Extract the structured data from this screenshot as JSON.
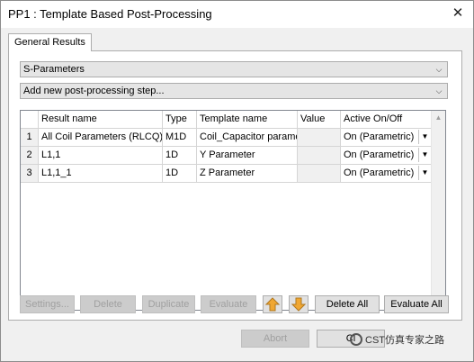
{
  "window": {
    "title": "PP1 : Template Based Post-Processing",
    "close_glyph": "✕"
  },
  "tabs": [
    {
      "label": "General Results"
    }
  ],
  "combos": {
    "result_type": "S-Parameters",
    "add_step": "Add new post-processing step..."
  },
  "table": {
    "headers": [
      "Result name",
      "Type",
      "Template name",
      "Value",
      "Active On/Off"
    ],
    "rows": [
      {
        "num": "1",
        "result_name": "All Coil Parameters (RLCQ)",
        "type": "M1D",
        "template": "Coil_Capacitor paramet",
        "value": "",
        "active": "On (Parametric)"
      },
      {
        "num": "2",
        "result_name": "L1,1",
        "type": "1D",
        "template": "Y Parameter",
        "value": "",
        "active": "On (Parametric)"
      },
      {
        "num": "3",
        "result_name": "L1,1_1",
        "type": "1D",
        "template": "Z Parameter",
        "value": "",
        "active": "On (Parametric)"
      }
    ]
  },
  "buttons": {
    "settings": "Settings...",
    "delete": "Delete",
    "duplicate": "Duplicate",
    "evaluate": "Evaluate",
    "delete_all": "Delete All",
    "evaluate_all": "Evaluate All",
    "abort": "Abort",
    "close": "Cl"
  },
  "watermark": {
    "text": "CST仿真专家之路"
  },
  "colors": {
    "arrow_button_fill": "#f0a732"
  }
}
